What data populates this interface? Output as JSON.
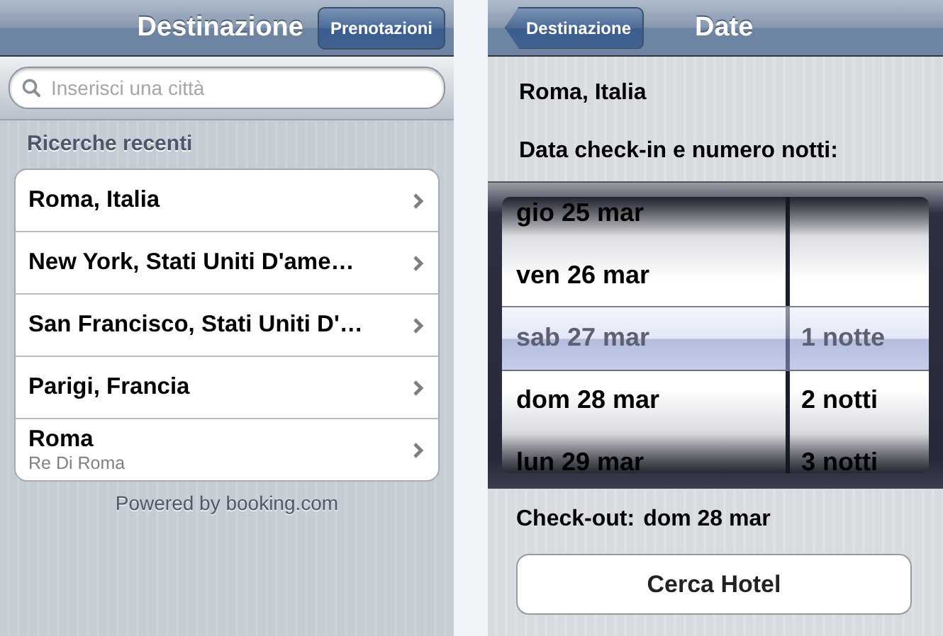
{
  "left_screen": {
    "nav_bar": {
      "title": "Destinazione",
      "right_button": "Prenotazioni"
    },
    "search": {
      "placeholder": "Inserisci una città"
    },
    "section_header": "Ricerche recenti",
    "recent_searches": [
      {
        "title": "Roma, Italia"
      },
      {
        "title": "New York, Stati Uniti D'ame…"
      },
      {
        "title": "San Francisco, Stati Uniti D'…"
      },
      {
        "title": "Parigi, Francia"
      },
      {
        "title": "Roma",
        "subtitle": "Re Di Roma"
      }
    ],
    "footer": "Powered by booking.com"
  },
  "right_screen": {
    "nav_bar": {
      "back_button": "Destinazione",
      "title": "Date"
    },
    "city": "Roma, Italia",
    "prompt": "Data check-in e numero notti:",
    "picker": {
      "dates": [
        {
          "label": "gio 25 mar",
          "selected": false
        },
        {
          "label": "ven 26 mar",
          "selected": false
        },
        {
          "label": "sab 27 mar",
          "selected": true
        },
        {
          "label": "dom 28 mar",
          "selected": false
        },
        {
          "label": "lun 29 mar",
          "selected": false
        }
      ],
      "nights": [
        {
          "label": "1 notte",
          "selected": true
        },
        {
          "label": "2 notti",
          "selected": false
        },
        {
          "label": "3 notti",
          "selected": false
        }
      ]
    },
    "checkout_label": "Check-out:",
    "checkout_value": "dom 28 mar",
    "search_button": "Cerca Hotel"
  }
}
